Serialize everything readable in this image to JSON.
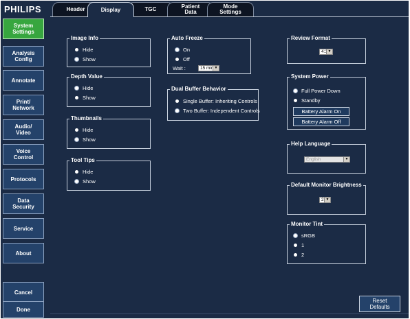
{
  "brand": "PHILIPS",
  "sidebar": {
    "items": [
      {
        "label": "System\nSettings"
      },
      {
        "label": "Analysis\nConfig"
      },
      {
        "label": "Annotate"
      },
      {
        "label": "Print/\nNetwork"
      },
      {
        "label": "Audio/\nVideo"
      },
      {
        "label": "Voice\nControl"
      },
      {
        "label": "Protocols"
      },
      {
        "label": "Data\nSecurity"
      },
      {
        "label": "Service"
      },
      {
        "label": "About"
      }
    ],
    "cancel": "Cancel",
    "done": "Done"
  },
  "tabs": [
    {
      "label": "Header"
    },
    {
      "label": "Display"
    },
    {
      "label": "TGC"
    },
    {
      "label": "Patient\nData"
    },
    {
      "label": "Mode\nSettings"
    }
  ],
  "image_info": {
    "title": "Image Info",
    "opt1": "Hide",
    "opt2": "Show",
    "selected": "Show"
  },
  "depth_value": {
    "title": "Depth Value",
    "opt1": "Hide",
    "opt2": "Show",
    "selected": "Hide"
  },
  "thumbnails": {
    "title": "Thumbnails",
    "opt1": "Hide",
    "opt2": "Show",
    "selected": "Show"
  },
  "tool_tips": {
    "title": "Tool Tips",
    "opt1": "Hide",
    "opt2": "Show",
    "selected": "Show"
  },
  "auto_freeze": {
    "title": "Auto Freeze",
    "opt1": "On",
    "opt2": "Off",
    "selected": "On",
    "wait_label": "Wait :",
    "wait_value": "15 min"
  },
  "dual_buffer": {
    "title": "Dual Buffer Behavior",
    "opt1": "Single Buffer: Inheriting Controls",
    "opt2": "Two Buffer: Independent Controls",
    "selected": "Two Buffer: Independent Controls"
  },
  "review_format": {
    "title": "Review Format",
    "value": "4:1"
  },
  "system_power": {
    "title": "System Power",
    "opt1": "Full Power Down",
    "opt2": "Standby",
    "selected": "Full Power Down",
    "battery_on": "Battery Alarm On",
    "battery_off": "Battery Alarm Off"
  },
  "help_language": {
    "title": "Help Language",
    "value": "English"
  },
  "monitor_brightness": {
    "title": "Default Monitor Brightness",
    "value": "2"
  },
  "monitor_tint": {
    "title": "Monitor Tint",
    "opt1": "sRGB",
    "opt2": "1",
    "opt3": "2",
    "selected": "sRGB"
  },
  "reset_defaults": "Reset\nDefaults"
}
